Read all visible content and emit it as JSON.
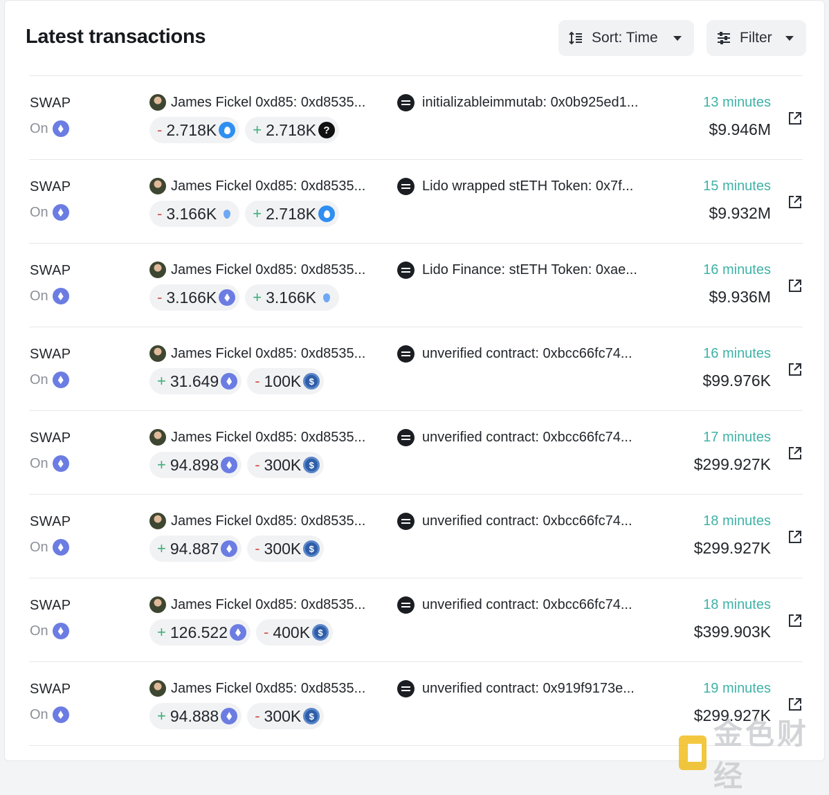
{
  "header": {
    "title": "Latest transactions",
    "sort_label": "Sort: Time",
    "filter_label": "Filter"
  },
  "rows": [
    {
      "type": "SWAP",
      "on": "On",
      "from": "James Fickel 0xd85: 0xd8535...",
      "to": "initializableimmutab: 0x0b925ed1...",
      "chip1": {
        "sign": "-",
        "amount": "2.718K",
        "token": "steth"
      },
      "chip2": {
        "sign": "+",
        "amount": "2.718K",
        "token": "unknown"
      },
      "time": "13 minutes",
      "usd": "$9.946M"
    },
    {
      "type": "SWAP",
      "on": "On",
      "from": "James Fickel 0xd85: 0xd8535...",
      "to": "Lido wrapped stETH Token: 0x7f...",
      "chip1": {
        "sign": "-",
        "amount": "3.166K",
        "token": "drop"
      },
      "chip2": {
        "sign": "+",
        "amount": "2.718K",
        "token": "steth"
      },
      "time": "15 minutes",
      "usd": "$9.932M"
    },
    {
      "type": "SWAP",
      "on": "On",
      "from": "James Fickel 0xd85: 0xd8535...",
      "to": "Lido Finance: stETH Token: 0xae...",
      "chip1": {
        "sign": "-",
        "amount": "3.166K",
        "token": "eth"
      },
      "chip2": {
        "sign": "+",
        "amount": "3.166K",
        "token": "drop"
      },
      "time": "16 minutes",
      "usd": "$9.936M"
    },
    {
      "type": "SWAP",
      "on": "On",
      "from": "James Fickel 0xd85: 0xd8535...",
      "to": "unverified contract: 0xbcc66fc74...",
      "chip1": {
        "sign": "+",
        "amount": "31.649",
        "token": "eth"
      },
      "chip2": {
        "sign": "-",
        "amount": "100K",
        "token": "usdc"
      },
      "time": "16 minutes",
      "usd": "$99.976K"
    },
    {
      "type": "SWAP",
      "on": "On",
      "from": "James Fickel 0xd85: 0xd8535...",
      "to": "unverified contract: 0xbcc66fc74...",
      "chip1": {
        "sign": "+",
        "amount": "94.898",
        "token": "eth"
      },
      "chip2": {
        "sign": "-",
        "amount": "300K",
        "token": "usdc"
      },
      "time": "17 minutes",
      "usd": "$299.927K"
    },
    {
      "type": "SWAP",
      "on": "On",
      "from": "James Fickel 0xd85: 0xd8535...",
      "to": "unverified contract: 0xbcc66fc74...",
      "chip1": {
        "sign": "+",
        "amount": "94.887",
        "token": "eth"
      },
      "chip2": {
        "sign": "-",
        "amount": "300K",
        "token": "usdc"
      },
      "time": "18 minutes",
      "usd": "$299.927K"
    },
    {
      "type": "SWAP",
      "on": "On",
      "from": "James Fickel 0xd85: 0xd8535...",
      "to": "unverified contract: 0xbcc66fc74...",
      "chip1": {
        "sign": "+",
        "amount": "126.522",
        "token": "eth"
      },
      "chip2": {
        "sign": "-",
        "amount": "400K",
        "token": "usdc"
      },
      "time": "18 minutes",
      "usd": "$399.903K"
    },
    {
      "type": "SWAP",
      "on": "On",
      "from": "James Fickel 0xd85: 0xd8535...",
      "to": "unverified contract: 0x919f9173e...",
      "chip1": {
        "sign": "+",
        "amount": "94.888",
        "token": "eth"
      },
      "chip2": {
        "sign": "-",
        "amount": "300K",
        "token": "usdc"
      },
      "time": "19 minutes",
      "usd": "$299.927K"
    }
  ],
  "watermark": {
    "text": "金色财经"
  },
  "colors": {
    "time": "#3fb2a6",
    "minus": "#d0524a",
    "plus": "#3dae77",
    "chip_bg": "#f1f2f4"
  }
}
